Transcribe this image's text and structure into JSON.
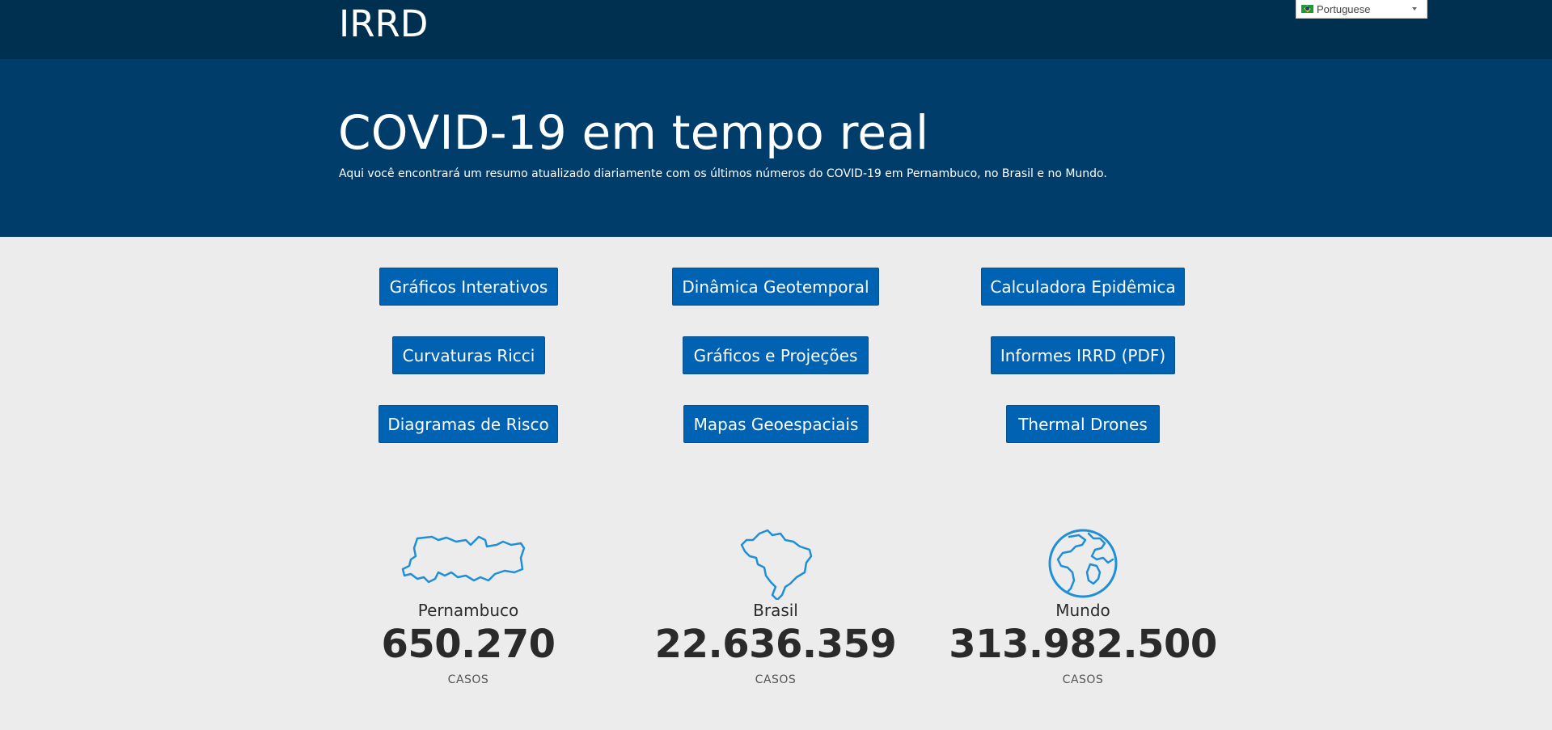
{
  "header": {
    "brand": "IRRD",
    "language": {
      "selected": "Portuguese",
      "flag": "brazil-flag-icon"
    }
  },
  "hero": {
    "title": "COVID-19 em tempo real",
    "subtitle": "Aqui você encontrará um resumo atualizado diariamente com os últimos números do COVID-19 em Pernambuco, no Brasil e no Mundo."
  },
  "buttons": [
    {
      "label": "Gráficos Interativos"
    },
    {
      "label": "Dinâmica Geotemporal"
    },
    {
      "label": "Calculadora Epidêmica"
    },
    {
      "label": "Curvaturas Ricci"
    },
    {
      "label": "Gráficos e Projeções"
    },
    {
      "label": "Informes IRRD (PDF)"
    },
    {
      "label": "Diagramas de Risco"
    },
    {
      "label": "Mapas Geoespaciais"
    },
    {
      "label": "Thermal Drones"
    }
  ],
  "stats": [
    {
      "icon": "pernambuco-map-icon",
      "label": "Pernambuco",
      "value": "650.270",
      "unit": "CASOS"
    },
    {
      "icon": "brazil-map-icon",
      "label": "Brasil",
      "value": "22.636.359",
      "unit": "CASOS"
    },
    {
      "icon": "globe-icon",
      "label": "Mundo",
      "value": "313.982.500",
      "unit": "CASOS"
    }
  ],
  "colors": {
    "topbar": "#00304f",
    "hero": "#003d6b",
    "button": "#0062b3",
    "icon": "#1f8fd6",
    "background": "#ececec"
  }
}
